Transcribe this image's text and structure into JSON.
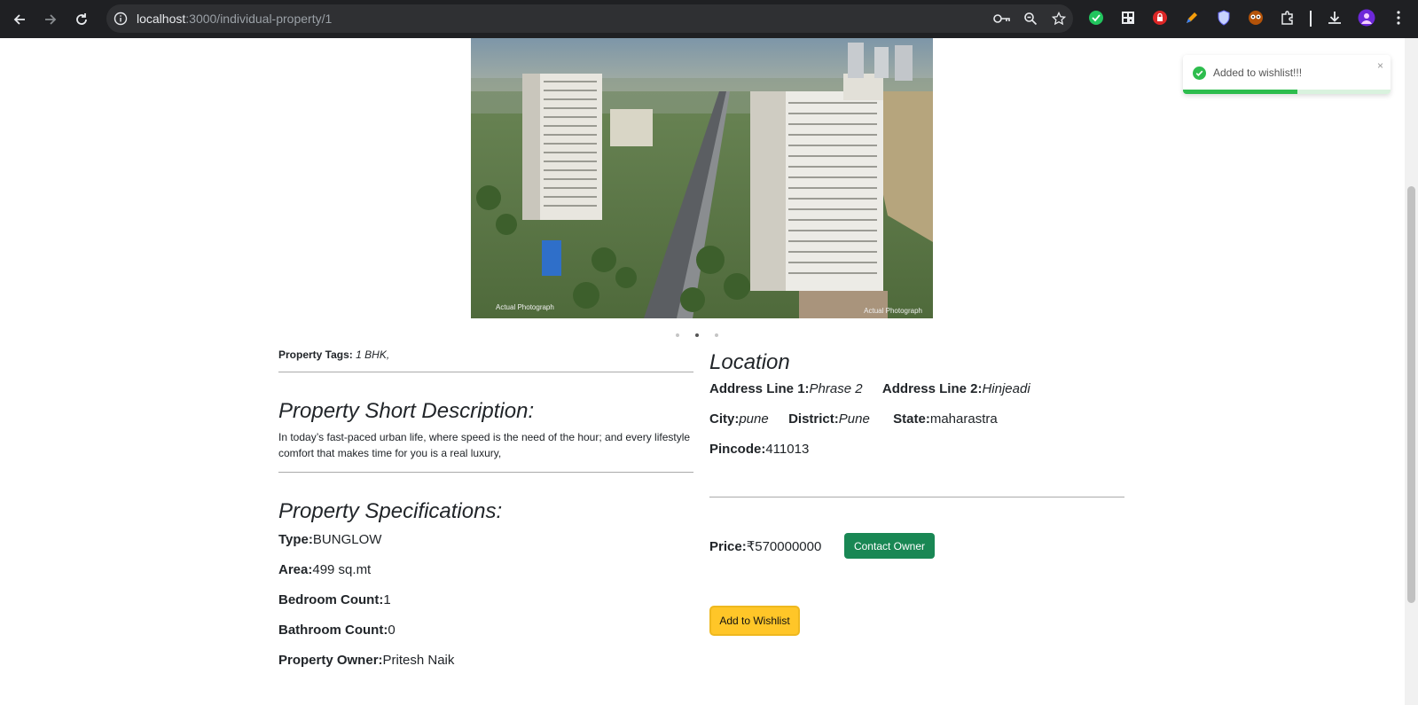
{
  "browser": {
    "url_host": "localhost",
    "url_path": ":3000/individual-property/1"
  },
  "carousel": {
    "caption_left": "Actual Photograph",
    "caption_right": "Actual Photograph",
    "slide_count": 3,
    "active_slide": 2
  },
  "tags": {
    "label": "Property Tags:",
    "value": "1 BHK,"
  },
  "short_description": {
    "heading": "Property Short Description:",
    "text": "In today’s fast-paced urban life, where speed is the need of the hour; and every lifestyle comfort that makes time for you is a real luxury,"
  },
  "specifications": {
    "heading": "Property Specifications:",
    "type_label": "Type:",
    "type_value": "BUNGLOW",
    "area_label": "Area:",
    "area_value": "499 sq.mt",
    "bedroom_label": "Bedroom Count:",
    "bedroom_value": "1",
    "bathroom_label": "Bathroom Count:",
    "bathroom_value": "0",
    "owner_label": "Property Owner:",
    "owner_value": "Pritesh Naik"
  },
  "location": {
    "heading": "Location",
    "addr1_label": "Address Line 1:",
    "addr1_value": "Phrase 2",
    "addr2_label": "Address Line 2:",
    "addr2_value": "Hinjeadi",
    "city_label": "City:",
    "city_value": "pune",
    "district_label": "District:",
    "district_value": "Pune",
    "state_label": "State:",
    "state_value": "maharastra",
    "pincode_label": "Pincode:",
    "pincode_value": "411013"
  },
  "pricing": {
    "price_label": "Price:",
    "price_value": "₹570000000",
    "contact_button": "Contact Owner",
    "wishlist_button": "Add to Wishlist"
  },
  "toast": {
    "message": "Added to wishlist!!!",
    "close": "×",
    "progress_fraction": 0.55,
    "color": "#2ebd4e"
  }
}
